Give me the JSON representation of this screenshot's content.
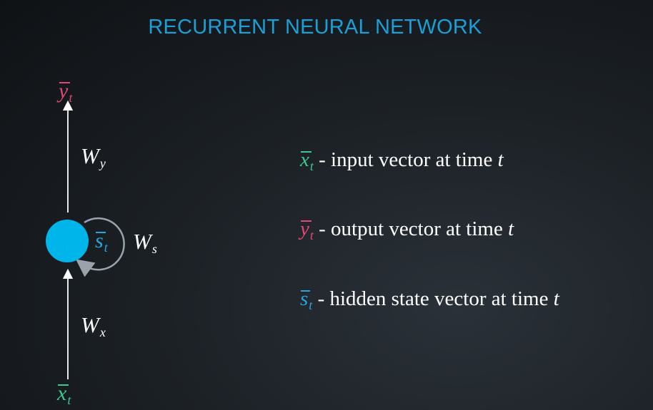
{
  "title": "RECURRENT NEURAL NETWORK",
  "colors": {
    "title": "#1a9fd6",
    "input": "#3ac98e",
    "output": "#e4486f",
    "hidden": "#27a6de",
    "node": "#00b5ea",
    "loop": "#9aa2ab",
    "arrow": "#ffffff"
  },
  "diagram": {
    "output_symbol": "y",
    "output_sub": "t",
    "input_symbol": "x",
    "input_sub": "t",
    "state_symbol": "s",
    "state_sub": "t",
    "weights": [
      {
        "symbol": "W",
        "sub": "y"
      },
      {
        "symbol": "W",
        "sub": "s"
      },
      {
        "symbol": "W",
        "sub": "x"
      }
    ]
  },
  "legend": [
    {
      "symbol": "x",
      "sub": "t",
      "text": " - input vector at time ",
      "t": "t"
    },
    {
      "symbol": "y",
      "sub": "t",
      "text": " - output vector at time ",
      "t": "t"
    },
    {
      "symbol": "s",
      "sub": "t",
      "text": " - hidden state vector at time ",
      "t": "t"
    }
  ]
}
